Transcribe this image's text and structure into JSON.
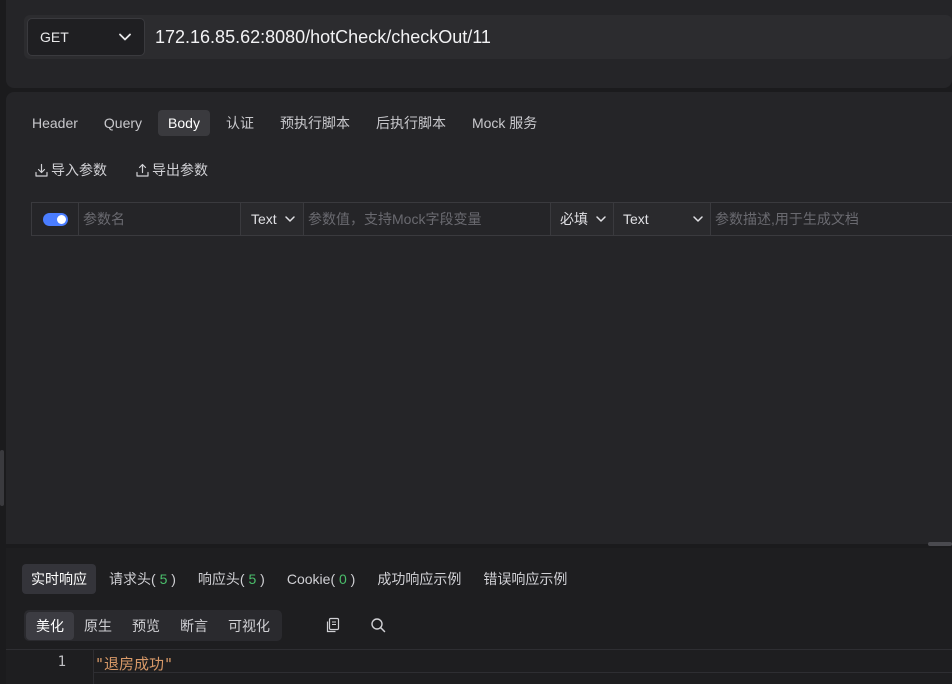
{
  "request": {
    "method": "GET",
    "url": "172.16.85.62:8080/hotCheck/checkOut/11"
  },
  "tabs": [
    {
      "label": "Header"
    },
    {
      "label": "Query"
    },
    {
      "label": "Body",
      "active": true
    },
    {
      "label": "认证"
    },
    {
      "label": "预执行脚本"
    },
    {
      "label": "后执行脚本"
    },
    {
      "label": "Mock 服务"
    }
  ],
  "body": {
    "import_label": "导入参数",
    "export_label": "导出参数",
    "param_row": {
      "enabled": true,
      "name_placeholder": "参数名",
      "type_value": "Text",
      "value_placeholder": "参数值，支持Mock字段变量",
      "required_value": "必填",
      "content_type_value": "Text",
      "desc_placeholder": "参数描述,用于生成文档"
    }
  },
  "response": {
    "tabs": [
      {
        "label": "实时响应",
        "active": true
      },
      {
        "label": "请求头",
        "count": "5"
      },
      {
        "label": "响应头",
        "count": "5"
      },
      {
        "label": "Cookie",
        "count": "0"
      },
      {
        "label": "成功响应示例"
      },
      {
        "label": "错误响应示例"
      }
    ],
    "view_tabs": [
      {
        "label": "美化",
        "active": true
      },
      {
        "label": "原生"
      },
      {
        "label": "预览"
      },
      {
        "label": "断言"
      },
      {
        "label": "可视化"
      }
    ],
    "code": {
      "line_number": "1",
      "content": "\"退房成功\""
    }
  },
  "colors": {
    "accent": "#4a7dff",
    "count_green": "#4bbf6b",
    "string_orange": "#d89968"
  }
}
